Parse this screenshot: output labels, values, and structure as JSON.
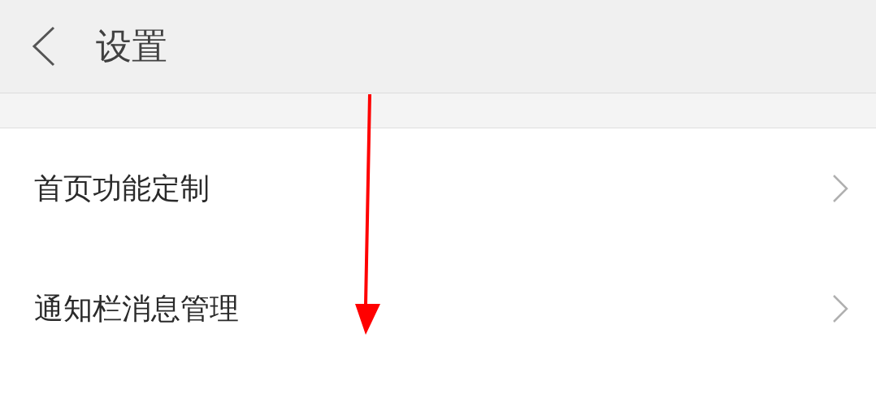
{
  "header": {
    "title": "设置"
  },
  "rows": [
    {
      "label": "首页功能定制"
    },
    {
      "label": "通知栏消息管理"
    }
  ]
}
